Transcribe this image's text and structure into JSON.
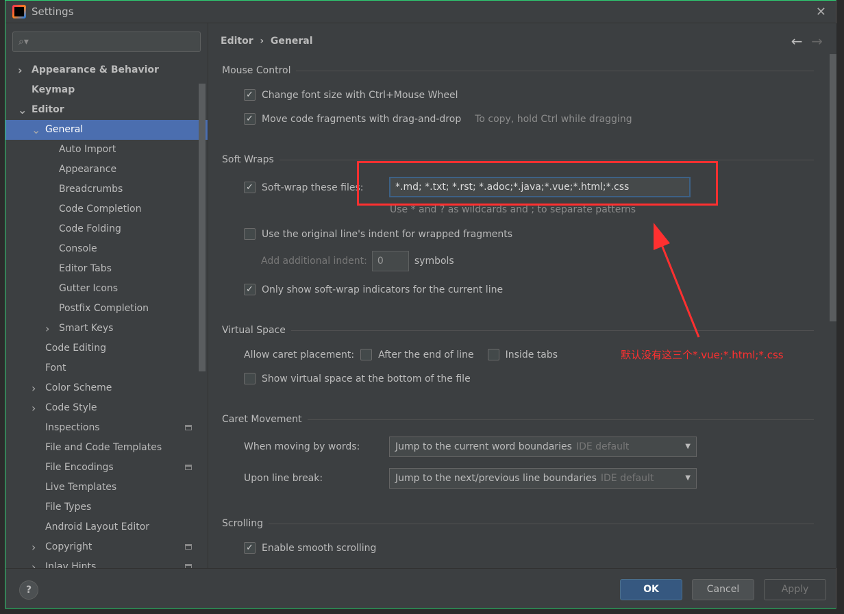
{
  "window": {
    "title": "Settings"
  },
  "search": {
    "placeholder": ""
  },
  "tree": [
    {
      "label": "Appearance & Behavior",
      "level": 0,
      "arrow": "right",
      "bold": true
    },
    {
      "label": "Keymap",
      "level": 0,
      "bold": true
    },
    {
      "label": "Editor",
      "level": 0,
      "arrow": "down",
      "bold": true
    },
    {
      "label": "General",
      "level": 1,
      "arrow": "down",
      "selected": true
    },
    {
      "label": "Auto Import",
      "level": 2
    },
    {
      "label": "Appearance",
      "level": 2
    },
    {
      "label": "Breadcrumbs",
      "level": 2
    },
    {
      "label": "Code Completion",
      "level": 2
    },
    {
      "label": "Code Folding",
      "level": 2
    },
    {
      "label": "Console",
      "level": 2
    },
    {
      "label": "Editor Tabs",
      "level": 2
    },
    {
      "label": "Gutter Icons",
      "level": 2
    },
    {
      "label": "Postfix Completion",
      "level": 2
    },
    {
      "label": "Smart Keys",
      "level": 2,
      "arrow": "right"
    },
    {
      "label": "Code Editing",
      "level": 1
    },
    {
      "label": "Font",
      "level": 1
    },
    {
      "label": "Color Scheme",
      "level": 1,
      "arrow": "right"
    },
    {
      "label": "Code Style",
      "level": 1,
      "arrow": "right"
    },
    {
      "label": "Inspections",
      "level": 1,
      "marker": true
    },
    {
      "label": "File and Code Templates",
      "level": 1
    },
    {
      "label": "File Encodings",
      "level": 1,
      "marker": true
    },
    {
      "label": "Live Templates",
      "level": 1
    },
    {
      "label": "File Types",
      "level": 1
    },
    {
      "label": "Android Layout Editor",
      "level": 1
    },
    {
      "label": "Copyright",
      "level": 1,
      "arrow": "right",
      "marker": true
    },
    {
      "label": "Inlay Hints",
      "level": 1,
      "arrow": "right",
      "marker": true
    }
  ],
  "breadcrumb": {
    "parent": "Editor",
    "sep": "›",
    "current": "General"
  },
  "sections": {
    "mouse": "Mouse Control",
    "soft": "Soft Wraps",
    "virtual": "Virtual Space",
    "caret": "Caret Movement",
    "scroll": "Scrolling"
  },
  "mouse": {
    "font_size": "Change font size with Ctrl+Mouse Wheel",
    "drag": "Move code fragments with drag-and-drop",
    "drag_hint": "To copy, hold Ctrl while dragging"
  },
  "soft": {
    "label": "Soft-wrap these files:",
    "value": "*.md; *.txt; *.rst; *.adoc;*.java;*.vue;*.html;*.css",
    "hint": "Use * and ? as wildcards and ; to separate patterns",
    "indent": "Use the original line's indent for wrapped fragments",
    "add_indent": "Add additional indent:",
    "add_indent_value": "0",
    "symbols": "symbols",
    "only_current": "Only show soft-wrap indicators for the current line"
  },
  "virtual": {
    "allow": "Allow caret placement:",
    "after_end": "After the end of line",
    "inside_tabs": "Inside tabs",
    "show_bottom": "Show virtual space at the bottom of the file"
  },
  "caret": {
    "words_label": "When moving by words:",
    "words_value": "Jump to the current word boundaries",
    "words_default": "IDE default",
    "break_label": "Upon line break:",
    "break_value": "Jump to the next/previous line boundaries",
    "break_default": "IDE default"
  },
  "scroll": {
    "smooth": "Enable smooth scrolling"
  },
  "annotation": {
    "text": "默认没有这三个*.vue;*.html;*.css",
    "color": "#ff3030"
  },
  "footer": {
    "ok": "OK",
    "cancel": "Cancel",
    "apply": "Apply",
    "help": "?"
  },
  "colors": {
    "accent": "#4b6eaf",
    "ok_button": "#365880"
  }
}
